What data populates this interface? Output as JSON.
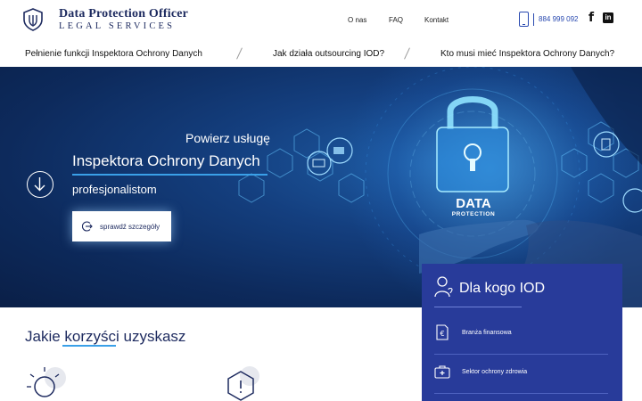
{
  "header": {
    "logo_title": "Data Protection Officer",
    "logo_subtitle": "LEGAL SERVICES",
    "logo_icon": "shield-icon",
    "nav": [
      "O nas",
      "FAQ",
      "Kontakt"
    ],
    "phone": "884 999 092",
    "social": [
      "facebook-icon",
      "linkedin-icon"
    ]
  },
  "subnav": {
    "items": [
      "Pełnienie funkcji Inspektora Ochrony Danych",
      "Jak działa outsourcing IOD?",
      "Kto musi mieć Inspektora Ochrony Danych?"
    ]
  },
  "hero": {
    "line1": "Powierz usługę",
    "line2": "Inspektora Ochrony Danych",
    "line3": "profesjonalistom",
    "button_label": "sprawdź szczegóły",
    "image_text_1": "DATA",
    "image_text_2": "PROTECTION"
  },
  "panel": {
    "title": "Dla kogo IOD",
    "items": [
      {
        "label": "Branża finansowa",
        "icon": "euro-document-icon"
      },
      {
        "label": "Sektor ochrony zdrowia",
        "icon": "medical-kit-icon"
      }
    ]
  },
  "benefits": {
    "title": "Jakie korzyści uzyskasz",
    "icons": [
      "lightbulb-icon",
      "alert-hexagon-icon"
    ]
  },
  "colors": {
    "brand_navy": "#1d2a5f",
    "accent_blue": "#3aa0e8",
    "panel_blue": "#283b9a",
    "phone_blue": "#2a4ab0"
  }
}
